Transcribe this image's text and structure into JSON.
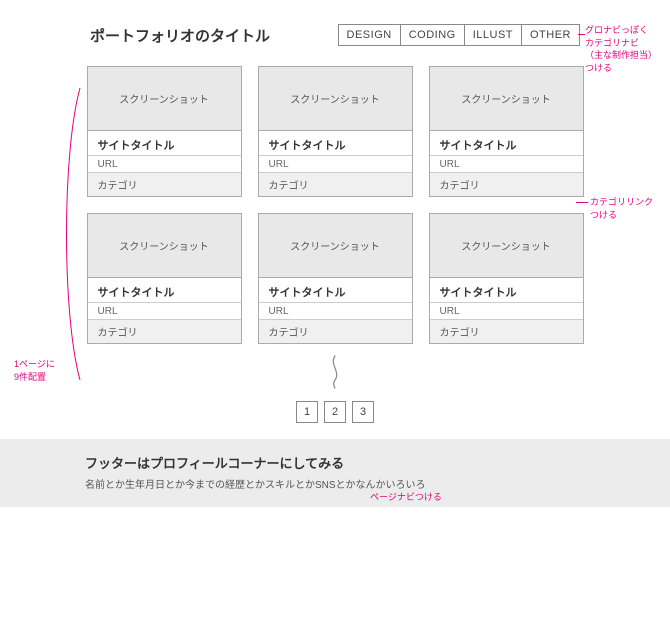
{
  "header": {
    "title": "ポートフォリオのタイトル",
    "nav": [
      "DESIGN",
      "CODING",
      "ILLUST",
      "OTHER"
    ]
  },
  "card": {
    "screenshot_label": "スクリーンショット",
    "site_title": "サイトタイトル",
    "url": "URL",
    "category": "カテゴリ"
  },
  "pager": [
    "1",
    "2",
    "3"
  ],
  "footer": {
    "title": "フッターはプロフィールコーナーにしてみる",
    "sub": "名前とか生年月日とか今までの経歴とかスキルとかSNSとかなんかいろいろ"
  },
  "annotations": {
    "nav_note_l1": "グロナビっぽく",
    "nav_note_l2": "カテゴリナビ",
    "nav_note_l3": "（主な制作担当）",
    "nav_note_l4": "つける",
    "cat_link_l1": "カテゴリリンク",
    "cat_link_l2": "つける",
    "per_page_l1": "1ページに",
    "per_page_l2": "9件配置",
    "pager_note": "ページナビつける"
  }
}
